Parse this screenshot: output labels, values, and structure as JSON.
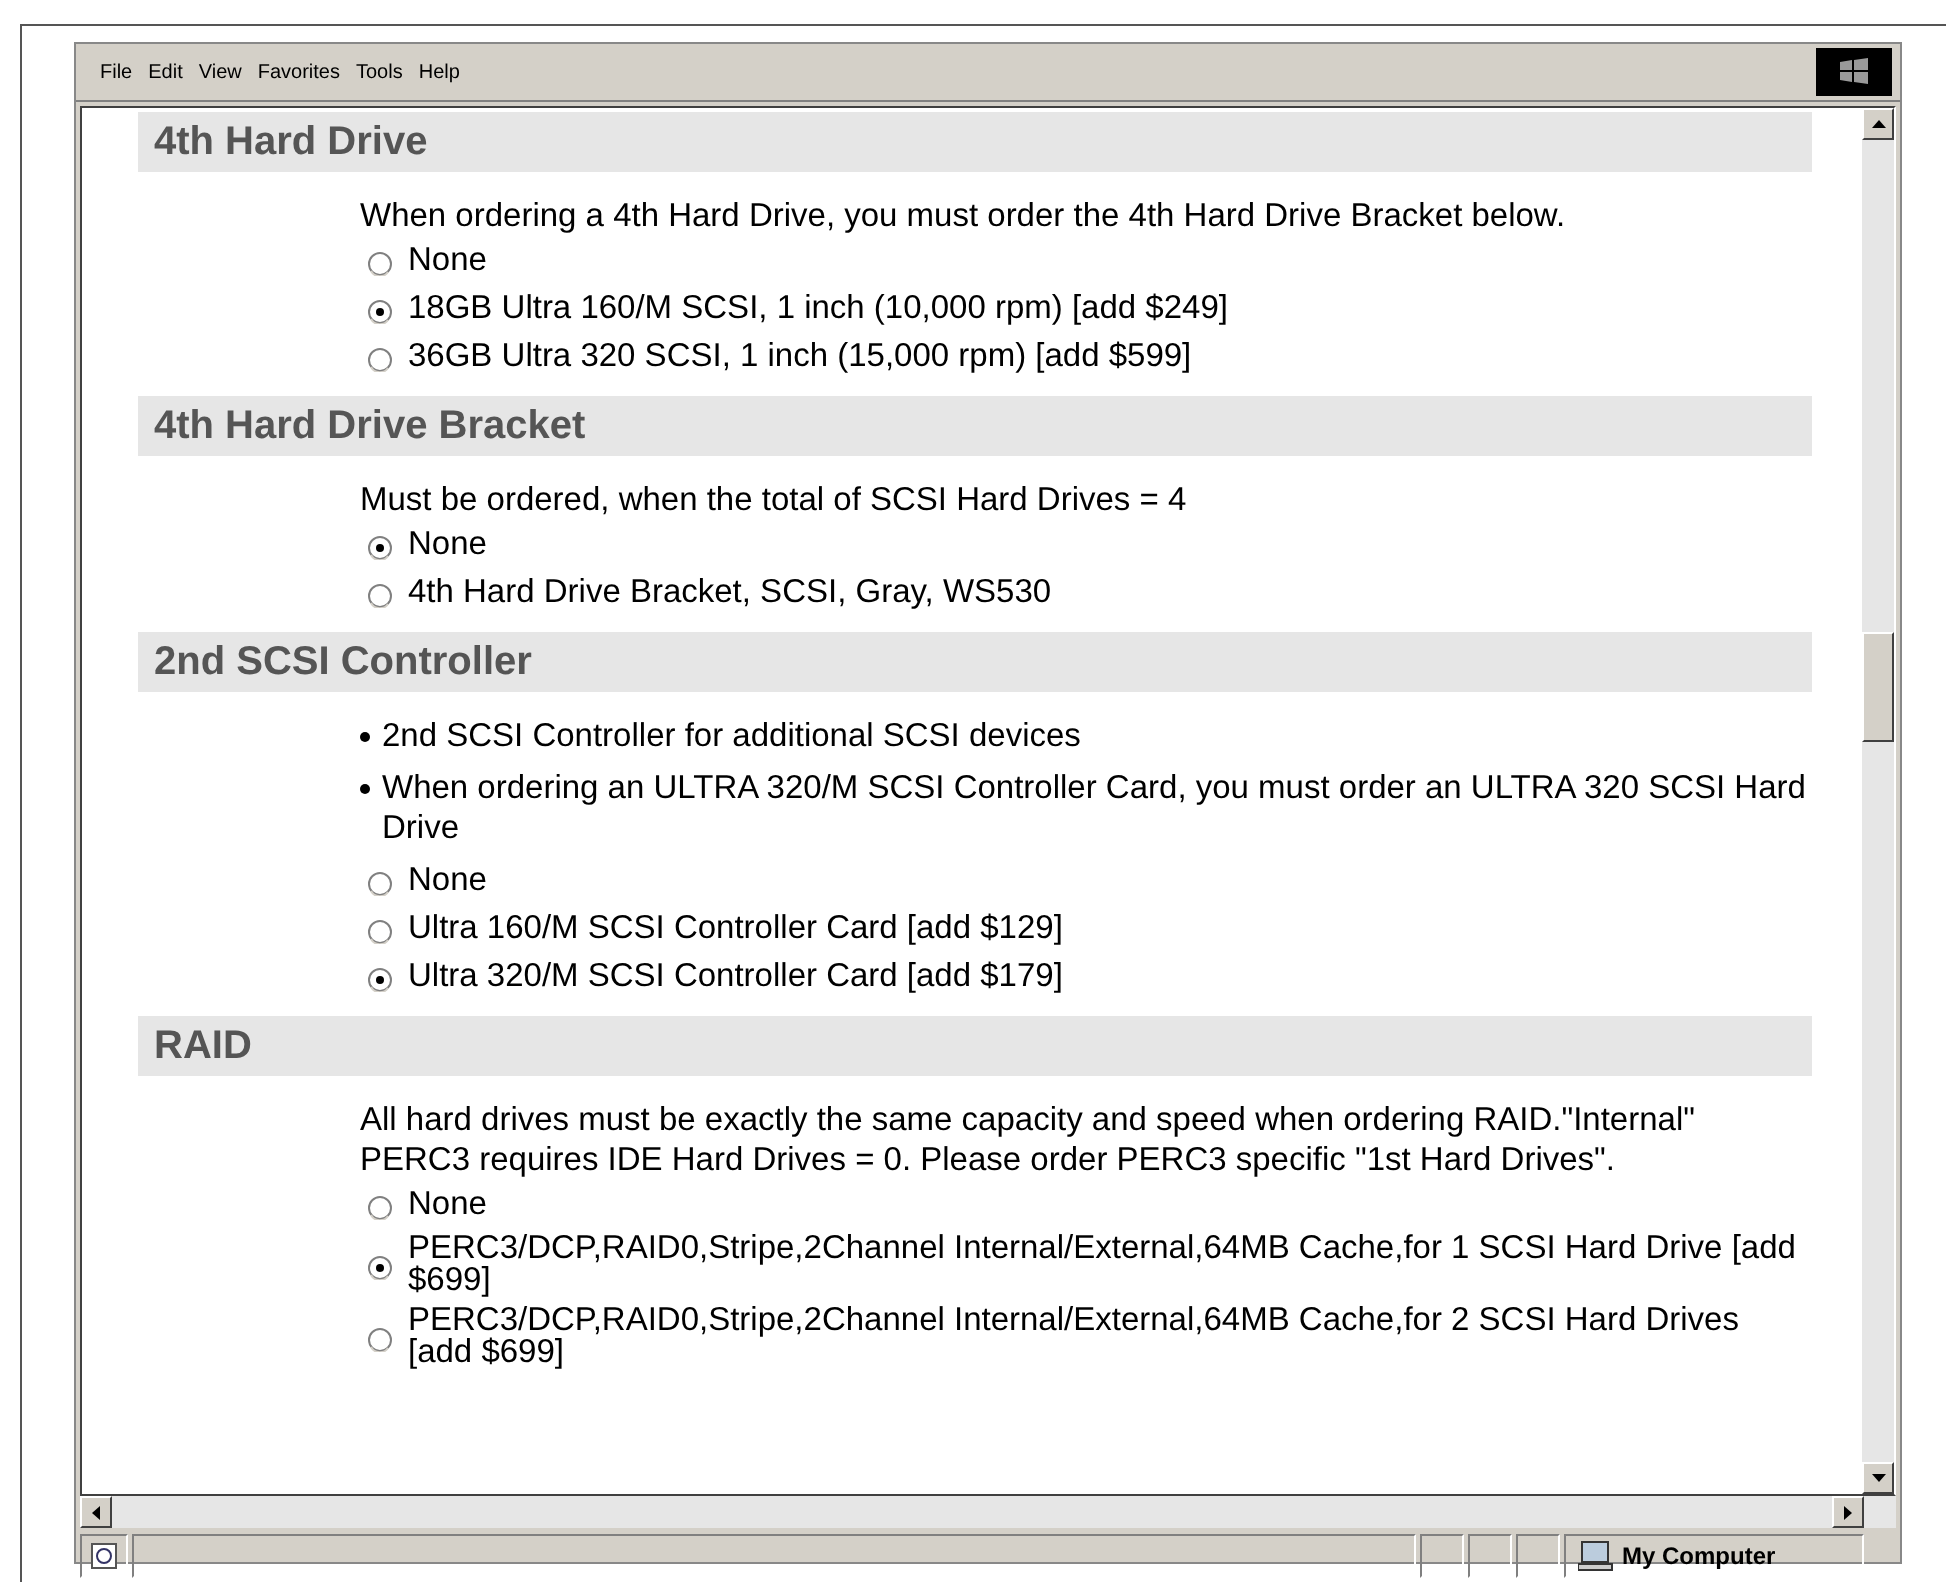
{
  "menu": [
    "File",
    "Edit",
    "View",
    "Favorites",
    "Tools",
    "Help"
  ],
  "sections": [
    {
      "title": "4th Hard Drive",
      "notes": [
        {
          "kind": "text",
          "text": "When ordering a 4th Hard Drive, you must order the 4th Hard Drive Bracket below."
        }
      ],
      "options": [
        {
          "label": "None",
          "selected": false
        },
        {
          "label": "18GB Ultra 160/M SCSI, 1 inch (10,000 rpm) [add $249]",
          "selected": true
        },
        {
          "label": "36GB Ultra 320 SCSI, 1 inch (15,000 rpm) [add $599]",
          "selected": false
        }
      ]
    },
    {
      "title": "4th Hard Drive Bracket",
      "notes": [
        {
          "kind": "text",
          "text": "Must be ordered, when the total of SCSI Hard Drives = 4"
        }
      ],
      "options": [
        {
          "label": "None",
          "selected": true
        },
        {
          "label": "4th Hard Drive Bracket, SCSI, Gray, WS530",
          "selected": false
        }
      ]
    },
    {
      "title": "2nd SCSI Controller",
      "notes": [
        {
          "kind": "bullet",
          "text": "2nd SCSI Controller for additional SCSI devices"
        },
        {
          "kind": "bullet",
          "text": "When ordering an ULTRA 320/M SCSI Controller Card, you must order an ULTRA 320 SCSI Hard Drive"
        }
      ],
      "options": [
        {
          "label": "None",
          "selected": false
        },
        {
          "label": "Ultra 160/M SCSI Controller Card [add $129]",
          "selected": false
        },
        {
          "label": "Ultra 320/M SCSI Controller Card [add $179]",
          "selected": true
        }
      ]
    },
    {
      "title": "RAID",
      "notes": [
        {
          "kind": "text",
          "text": "All hard drives must be exactly the same capacity and speed when ordering RAID.\"Internal\" PERC3 requires IDE Hard Drives = 0. Please order PERC3 specific \"1st Hard Drives\"."
        }
      ],
      "options": [
        {
          "label": "None",
          "selected": false
        },
        {
          "label": "PERC3/DCP,RAID0,Stripe,2Channel Internal/External,64MB Cache,for 1 SCSI Hard Drive [add $699]",
          "selected": true
        },
        {
          "label": "PERC3/DCP,RAID0,Stripe,2Channel Internal/External,64MB Cache,for 2 SCSI Hard Drives [add $699]",
          "selected": false
        }
      ]
    }
  ],
  "status_bar": {
    "zone": "My Computer"
  }
}
